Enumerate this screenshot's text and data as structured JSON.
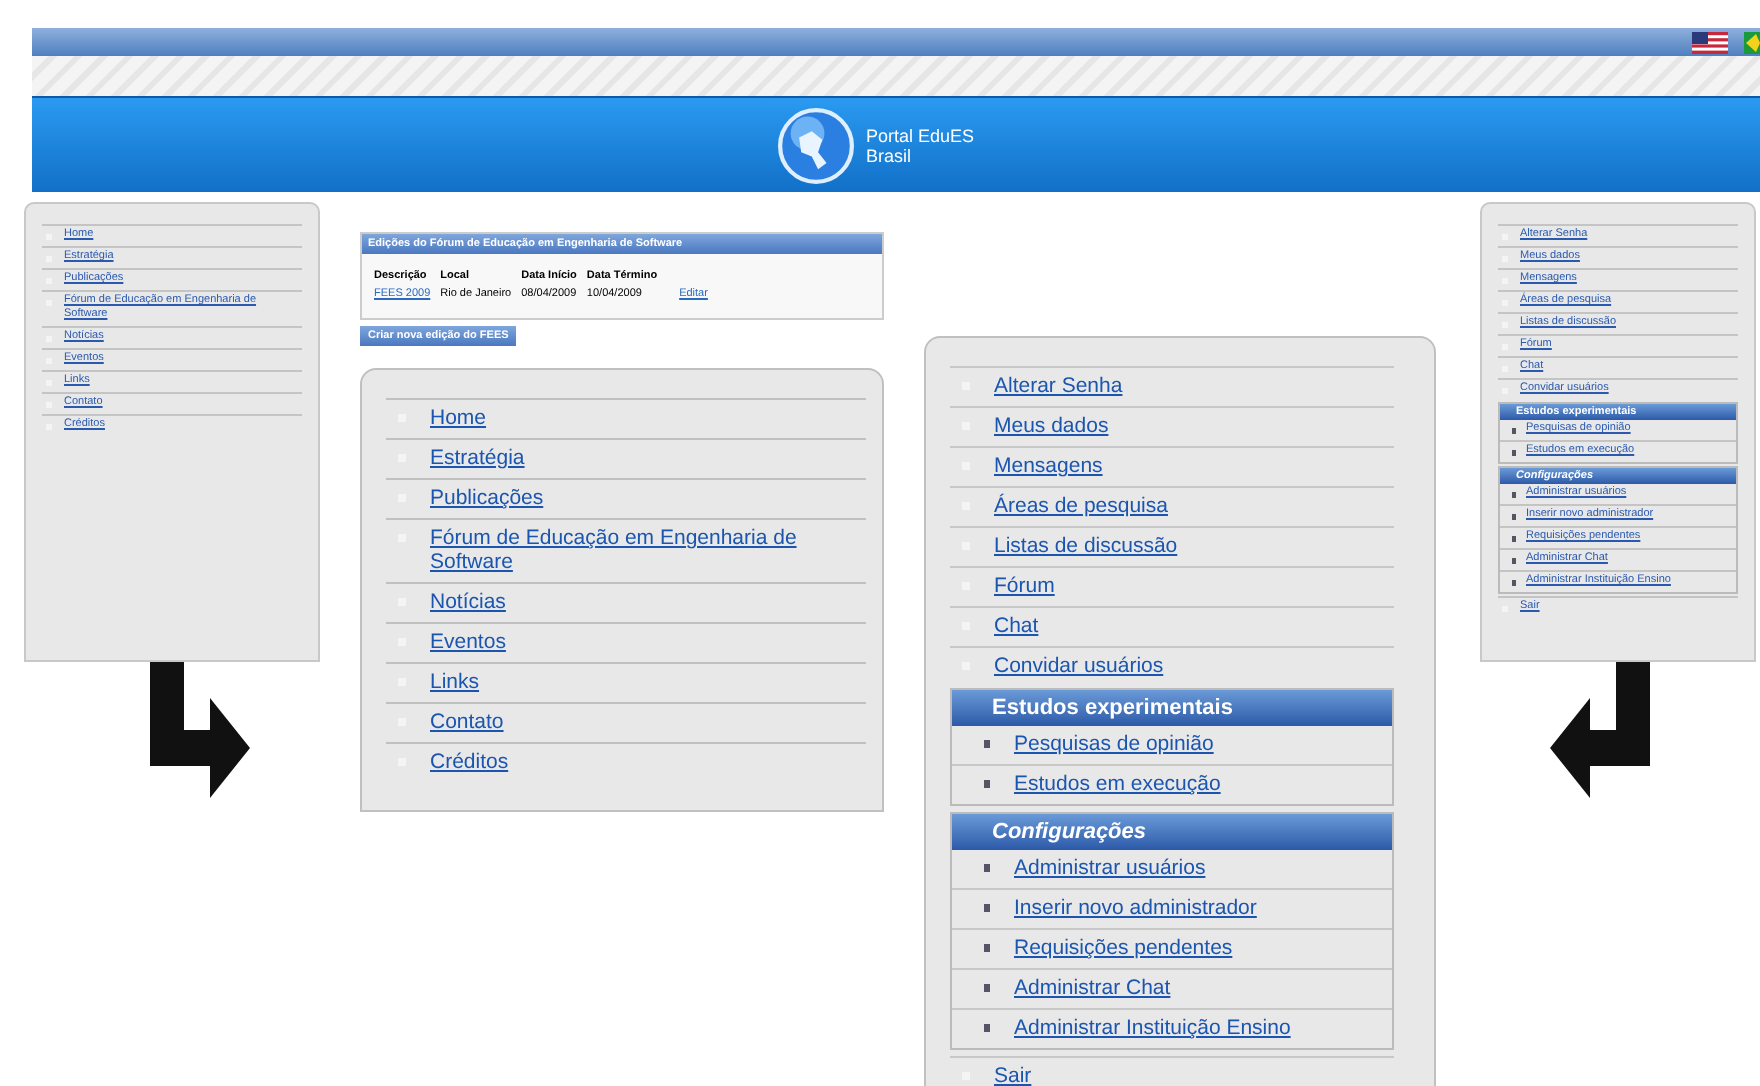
{
  "header": {
    "title_lines": [
      "Portal EduES",
      "Brasil"
    ]
  },
  "main_menu_small": {
    "items": [
      "Home",
      "Estratégia",
      "Publicações",
      "Fórum de Educação em Engenharia de Software",
      "Notícias",
      "Eventos",
      "Links",
      "Contato",
      "Créditos"
    ]
  },
  "fees_table": {
    "title": "Edições do Fórum de Educação em Engenharia de Software",
    "columns": [
      "Descrição",
      "Local",
      "Data Início",
      "Data Término"
    ],
    "rows": [
      {
        "name": "FEES 2009",
        "local": "Rio de Janeiro",
        "start": "08/04/2009",
        "end": "10/04/2009",
        "action": "Editar"
      }
    ],
    "button": "Criar nova edição do FEES"
  },
  "main_menu": {
    "items": [
      "Home",
      "Estratégia",
      "Publicações",
      "Fórum de Educação em Engenharia de Software",
      "Notícias",
      "Eventos",
      "Links",
      "Contato",
      "Créditos"
    ]
  },
  "user_menu": {
    "items": [
      "Alterar Senha",
      "Meus dados",
      "Mensagens",
      "Áreas de pesquisa",
      "Listas de discussão",
      "Fórum",
      "Chat",
      "Convidar usuários"
    ],
    "sections": [
      {
        "title": "Estudos experimentais",
        "kind": "plain",
        "items": [
          "Pesquisas de opinião",
          "Estudos em execução"
        ]
      },
      {
        "title": "Configurações",
        "kind": "italic",
        "items": [
          "Administrar usuários",
          "Inserir novo administrador",
          "Requisições pendentes",
          "Administrar Chat",
          "Administrar Instituição Ensino"
        ]
      }
    ],
    "footer_items": [
      "Sair"
    ]
  },
  "user_menu_small": {
    "items": [
      "Alterar Senha",
      "Meus dados",
      "Mensagens",
      "Áreas de pesquisa",
      "Listas de discussão",
      "Fórum",
      "Chat",
      "Convidar usuários"
    ],
    "sections": [
      {
        "title": "Estudos experimentais",
        "kind": "plain",
        "items": [
          "Pesquisas de opinião",
          "Estudos em execução"
        ]
      },
      {
        "title": "Configurações",
        "kind": "italic",
        "items": [
          "Administrar usuários",
          "Inserir novo administrador",
          "Requisições pendentes",
          "Administrar Chat",
          "Administrar Instituição Ensino"
        ]
      }
    ],
    "footer_items": [
      "Sair"
    ]
  }
}
